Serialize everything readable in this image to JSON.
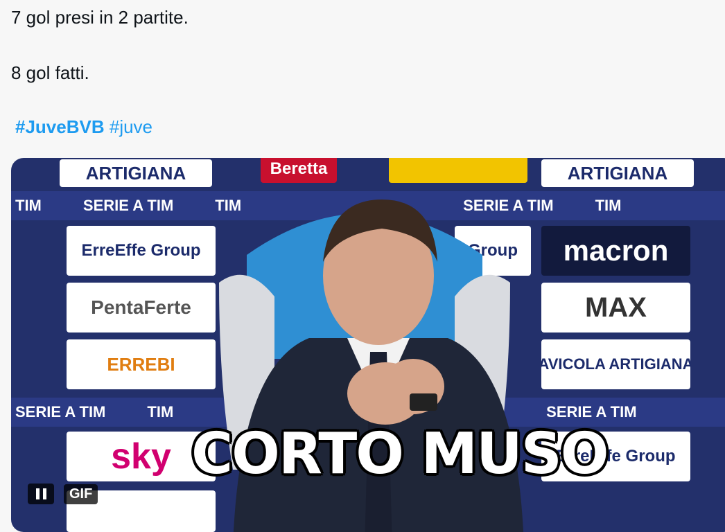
{
  "tweet": {
    "line1": "7 gol presi in 2 partite.",
    "line2": "8 gol fatti.",
    "hashtag1": "#JuveBVB",
    "hashtag2": "#juve"
  },
  "media": {
    "caption": "CORTO MUSO",
    "gif_badge": "GIF",
    "pause_icon": "pause-icon",
    "sponsors": {
      "artigiana": "ARTIGIANA",
      "beretta": "Beretta",
      "tim": "TIM",
      "seriea": "SERIE A TIM",
      "erreeffe": "ErreEffe Group",
      "macron": "macron",
      "pentaferte": "PentaFerte",
      "max": "MAX",
      "erreb": "ERREBI",
      "avicola": "AVICOLA ARTIGIANA",
      "sky": "sky",
      "group": "Group"
    }
  },
  "colors": {
    "hashtag": "#1d9bf0",
    "background": "#f7f7f7",
    "wall": "#1f2a66"
  }
}
